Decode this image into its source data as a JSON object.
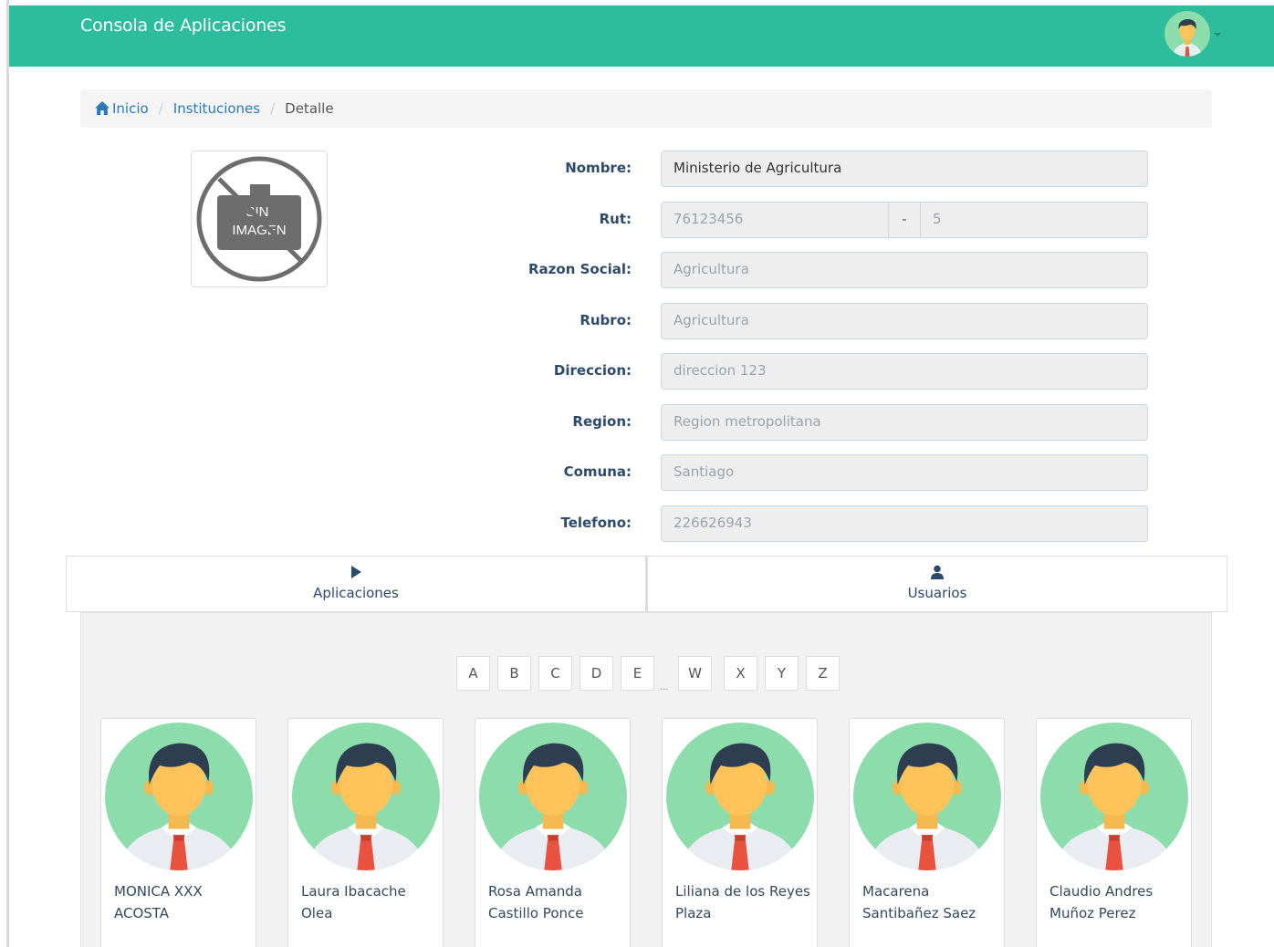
{
  "app": {
    "title": "Consola de Aplicaciones"
  },
  "user_menu": {
    "icon": "user-avatar-icon"
  },
  "breadcrumb": {
    "home": "Inicio",
    "institutions": "Instituciones",
    "current": "Detalle",
    "separator": "/"
  },
  "image_placeholder": {
    "line1": "SIN",
    "line2": "IMAGEN"
  },
  "form": {
    "nombre": {
      "label": "Nombre:",
      "value": "Ministerio de Agricultura"
    },
    "rut": {
      "label": "Rut:",
      "value": "76123456",
      "separator": "-",
      "dv": "5"
    },
    "razon_social": {
      "label": "Razon Social:",
      "value": "Agricultura"
    },
    "rubro": {
      "label": "Rubro:",
      "value": "Agricultura"
    },
    "direccion": {
      "label": "Direccion:",
      "value": "direccion 123"
    },
    "region": {
      "label": "Region:",
      "value": "Region metropolitana"
    },
    "comuna": {
      "label": "Comuna:",
      "value": "Santiago"
    },
    "telefono": {
      "label": "Telefono:",
      "value": "226626943"
    }
  },
  "tabs": [
    {
      "label": "Aplicaciones",
      "icon": "play-icon"
    },
    {
      "label": "Usuarios",
      "icon": "user-icon"
    }
  ],
  "letters": [
    "A",
    "B",
    "C",
    "D",
    "E",
    "W",
    "X",
    "Y",
    "Z"
  ],
  "letters_ellipsis": "...",
  "users": [
    {
      "line1": "MONICA XXX",
      "line2": "ACOSTA"
    },
    {
      "line1": "Laura Ibacache",
      "line2": "Olea"
    },
    {
      "line1": "Rosa Amanda",
      "line2": "Castillo Ponce"
    },
    {
      "line1": "Liliana de los Reyes",
      "line2": "Plaza"
    },
    {
      "line1": "Macarena",
      "line2": "Santibañez Saez"
    },
    {
      "line1": "Claudio Andres",
      "line2": "Muñoz Perez"
    }
  ],
  "colors": {
    "header": "#2dbd9c",
    "link": "#2a7ab8",
    "label": "#2d4a6b",
    "avatar_bg": "#8ddcab",
    "tie": "#e8523f"
  }
}
